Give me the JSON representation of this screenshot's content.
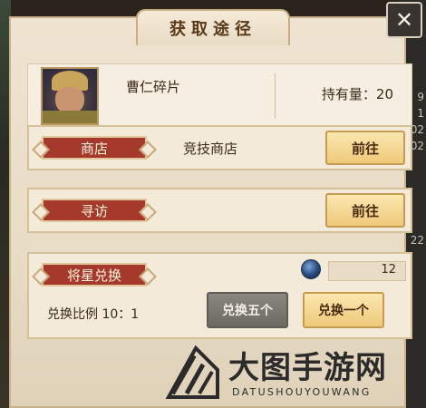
{
  "dialog": {
    "title": "获取途径",
    "close_label": "✕"
  },
  "item": {
    "name": "曹仁碎片",
    "owned_label": "持有量：20"
  },
  "sources": [
    {
      "label": "商店",
      "detail": "竞技商店",
      "button": "前往"
    },
    {
      "label": "寻访",
      "detail": "",
      "button": "前往"
    }
  ],
  "exchange": {
    "label": "将星兑换",
    "currency_count": "12",
    "ratio_text": "兑换比例 10：1",
    "button_five": "兑换五个",
    "button_one": "兑换一个",
    "currency_icon": "star-coin-icon"
  },
  "background": {
    "right_numbers": [
      "9",
      "1",
      "02",
      "02",
      "22"
    ]
  },
  "watermark": {
    "title": "大图手游网",
    "subtitle": "DATUSHOUYOUWANG"
  },
  "colors": {
    "ribbon_red": "#a53a2c",
    "gold_button": "#eec97a",
    "gray_button": "#7a766f",
    "panel_bg": "#efe4d1"
  }
}
